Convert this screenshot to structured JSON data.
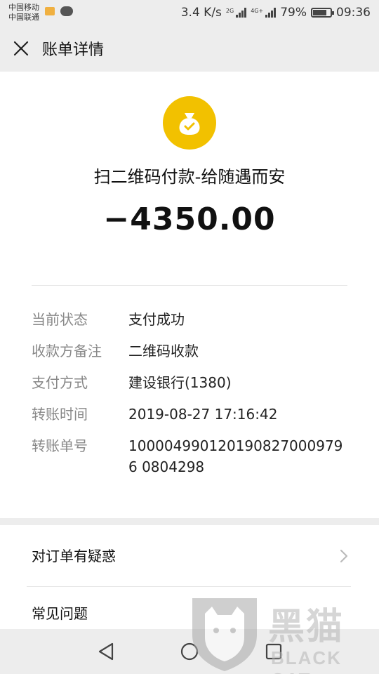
{
  "status_bar": {
    "carrier_1": "中国移动",
    "carrier_2": "中国联通",
    "network_speed": "3.4 K/s",
    "signal_1_label": "2G",
    "signal_2_label": "4G+",
    "battery": "79%",
    "battery_level": 0.79,
    "time": "09:36"
  },
  "header": {
    "title": "账单详情",
    "close_icon": "close-icon"
  },
  "transaction": {
    "merchant_icon": "money-bag-check-icon",
    "merchant_icon_color": "#f2c100",
    "title": "扫二维码付款-给随遇而安",
    "amount": "−4350.00"
  },
  "details": [
    {
      "label": "当前状态",
      "value": "支付成功"
    },
    {
      "label": "收款方备注",
      "value": "二维码收款"
    },
    {
      "label": "支付方式",
      "value": "建设银行(1380)"
    },
    {
      "label": "转账时间",
      "value": "2019-08-27 17:16:42"
    },
    {
      "label": "转账单号",
      "value": "1000049901201908270009796 0804298"
    }
  ],
  "links": [
    {
      "label": "对订单有疑惑"
    },
    {
      "label": "常见问题"
    }
  ],
  "nav": {
    "back_icon": "back-triangle-icon",
    "home_icon": "home-circle-icon",
    "recents_icon": "recents-square-icon"
  },
  "watermark": {
    "chinese": "黑猫",
    "english": "BLACK CAT"
  }
}
